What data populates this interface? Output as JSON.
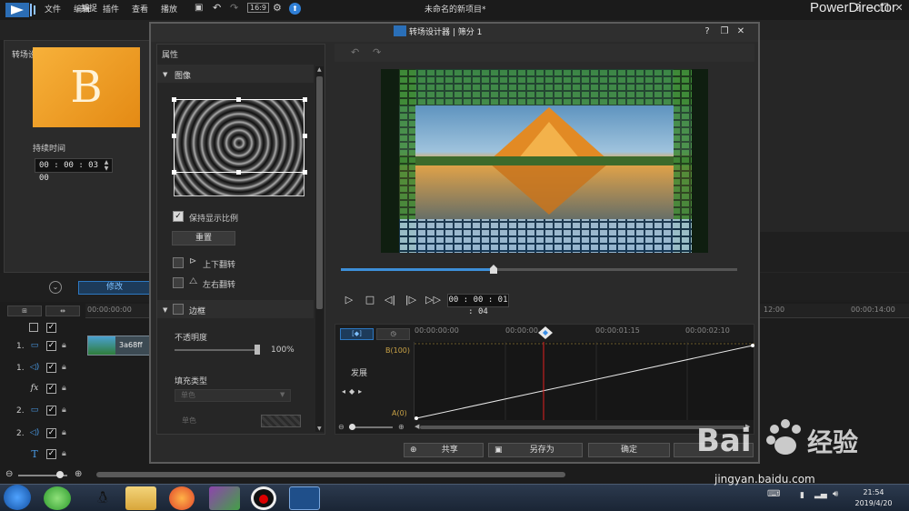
{
  "app": {
    "menu": [
      "文件",
      "编辑",
      "插件",
      "查看",
      "播放"
    ],
    "document_title": "未命名的新项目*",
    "brand": "PowerDirector",
    "capture_tab": "捕捉",
    "window_controls": [
      "?",
      "—",
      "❐",
      "✕"
    ]
  },
  "transition_settings": {
    "title": "转场设置",
    "preview_letter": "B",
    "duration_label": "持续时间",
    "duration_value": "00 : 00 : 03 : 00"
  },
  "modify_button": "修改",
  "timeline": {
    "ruler_labels": [
      "00:00:00:00",
      "12:00",
      "00:00:14:00"
    ],
    "tracks": [
      {
        "num": "",
        "icon": "select-all"
      },
      {
        "num": "1.",
        "icon": "video-track-icon"
      },
      {
        "num": "1.",
        "icon": "audio-track-icon"
      },
      {
        "num": "",
        "icon": "fx-track-icon",
        "icon_text": "fx"
      },
      {
        "num": "2.",
        "icon": "video-track-icon"
      },
      {
        "num": "2.",
        "icon": "audio-track-icon"
      },
      {
        "num": "",
        "icon": "title-track-icon",
        "icon_text": "T"
      }
    ],
    "clip_label": "3a68ff"
  },
  "taskbar": {
    "time": "21:54",
    "date": "2019/4/20"
  },
  "dialog": {
    "title": "转场设计器 | 筛分 1",
    "controls": [
      "?",
      "❐",
      "✕"
    ],
    "properties_title": "属性",
    "image_section": "图像",
    "keep_ratio_label": "保持显示比例",
    "keep_ratio_checked": true,
    "reset_button": "重置",
    "flip_vertical": "上下翻转",
    "flip_horizontal": "左右翻转",
    "border_section": "边框",
    "opacity_label": "不透明度",
    "opacity_value": "100%",
    "opacity_fraction": 1.0,
    "fill_type_label": "填充类型",
    "fill_type_value": "单色",
    "single_color_label": "单色",
    "playback_time": "00 : 00 : 01 : 04",
    "playhead_fraction": 0.38,
    "kf_times": [
      "00:00:00:00",
      "00:00:00",
      "00:00:01:15",
      "00:00:02:10"
    ],
    "kf_b_label": "B(100)",
    "kf_a_label": "A(0)",
    "kf_param": "发展",
    "buttons": [
      "共享",
      "另存为",
      "确定"
    ]
  },
  "watermark": {
    "text": "经验",
    "logo_text": "Bai",
    "url": "jingyan.baidu.com"
  }
}
